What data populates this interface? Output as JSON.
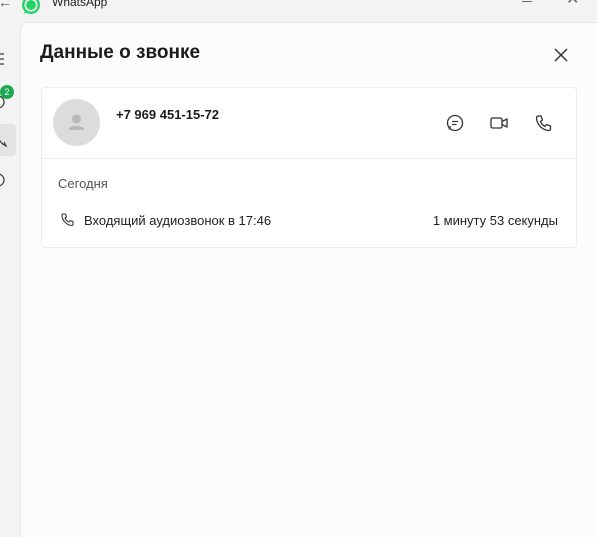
{
  "window": {
    "title": "WhatsApp",
    "icons": {
      "back": "back-arrow-icon",
      "logo": "whatsapp-logo-icon",
      "minimize": "minimize-icon",
      "close": "window-close-icon"
    }
  },
  "rail": {
    "chats_badge": "2",
    "icons": [
      "menu-icon",
      "chats-icon",
      "calls-icon",
      "status-icon"
    ]
  },
  "panel": {
    "title": "Данные о звонке",
    "close_icon": "close-icon"
  },
  "contact": {
    "phone": "+7 969 451-15-72",
    "actions": [
      "message-icon",
      "video-call-icon",
      "voice-call-icon"
    ]
  },
  "call_log": {
    "day": "Сегодня",
    "entries": [
      {
        "icon": "incoming-call-icon",
        "description": "Входящий аудиозвонок в 17:46",
        "duration": "1 минуту 53 секунды"
      }
    ]
  },
  "colors": {
    "accent": "#1da851",
    "background": "#f3f3f3",
    "panel": "#fcfcfc"
  }
}
